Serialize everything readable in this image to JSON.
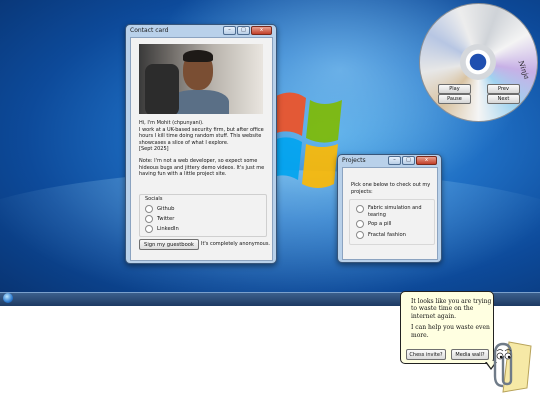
{
  "contact_window": {
    "title": "Contact card",
    "controls": {
      "minimize": "–",
      "maximize": "□",
      "close": "x"
    },
    "bio": [
      "Hi, I'm Mohit (chpunyani).",
      "I work at a UK-based security firm, but after office",
      "hours I kill time doing random stuff. This website",
      "showcases a slice of what I explore.",
      "[Sept 2025]"
    ],
    "note": [
      "Note: I'm not a web developer, so expect some",
      "hideous bugs and jittery demo videos. It's just me",
      "having fun with a little project site."
    ],
    "socials_label": "Socials",
    "socials": [
      "Github",
      "Twitter",
      "LinkedIn"
    ],
    "guestbook_button": "Sign my guestbook",
    "guestbook_note": "It's completely anonymous."
  },
  "projects_window": {
    "title": "Projects",
    "intro": [
      "Pick one below to check out my",
      "projects:"
    ],
    "items": [
      {
        "label_lines": [
          "Fabric simulation and",
          "tearing"
        ]
      },
      {
        "label_lines": [
          "Pop a pill"
        ]
      },
      {
        "label_lines": [
          "Fractal fashion"
        ]
      }
    ]
  },
  "cd_player": {
    "disc_text": "Ninja",
    "buttons": {
      "play": "Play",
      "prev": "Prev",
      "pause": "Pause",
      "next": "Next"
    }
  },
  "clippy": {
    "lines": [
      "It looks like you are trying",
      "to waste time on the",
      "internet again.",
      "",
      "I can help you waste even",
      "more."
    ],
    "buttons": [
      "Chess invite?",
      "Media wall?"
    ]
  },
  "colors": {
    "accent": "#1f6fc4",
    "tooltip_bg": "#ffffe1"
  },
  "icons": [
    "windows-start-orb-icon",
    "windows-flag-icon",
    "cd-disc-icon",
    "clippy-paperclip-icon"
  ]
}
